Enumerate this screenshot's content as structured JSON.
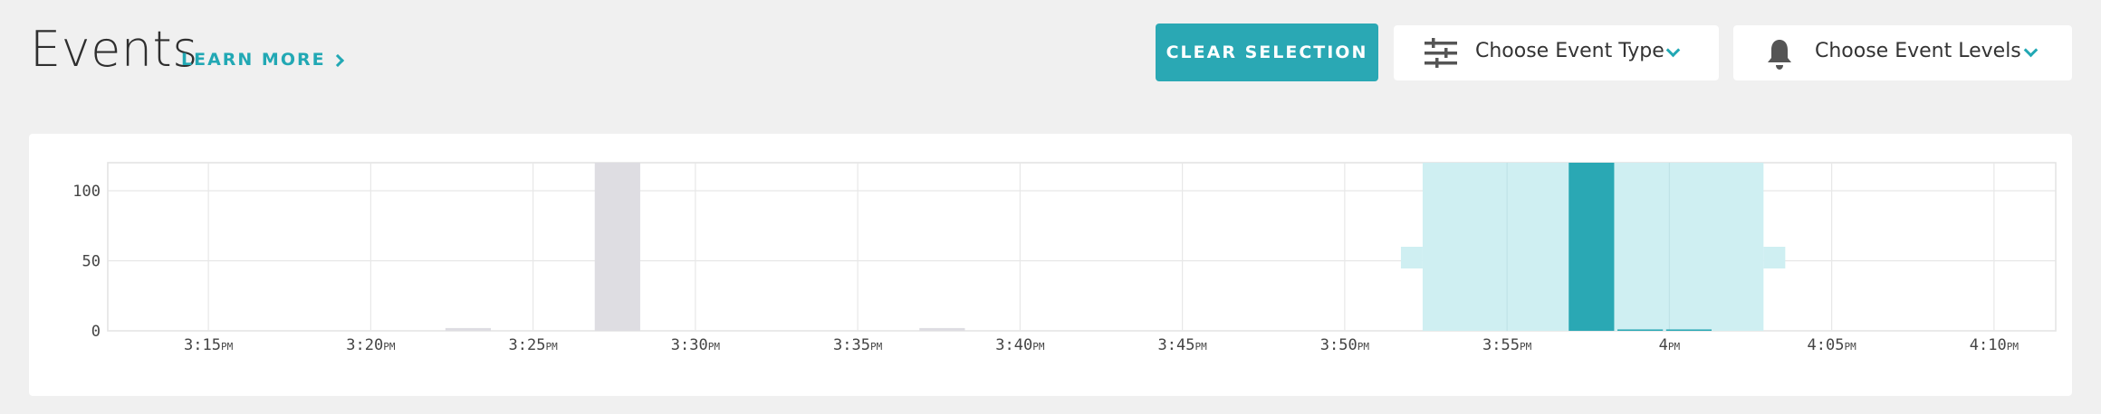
{
  "header": {
    "title": "Events",
    "learn_more": "LEARN MORE"
  },
  "toolbar": {
    "clear_selection": "CLEAR SELECTION",
    "event_type": {
      "label": "Choose Event Type",
      "icon": "sliders-icon"
    },
    "event_levels": {
      "label": "Choose Event Levels",
      "icon": "bell-icon"
    }
  },
  "colors": {
    "accent": "#2aa8b4",
    "selection": "#cfeff2",
    "bar_gray": "#dedde2",
    "background": "#f0f0f0"
  },
  "chart_data": {
    "type": "bar",
    "y_ticks": [
      "0",
      "50",
      "100"
    ],
    "ylim": [
      0,
      120
    ],
    "x_ticks": [
      {
        "label": "3:15",
        "suffix": "PM"
      },
      {
        "label": "3:20",
        "suffix": "PM"
      },
      {
        "label": "3:25",
        "suffix": "PM"
      },
      {
        "label": "3:30",
        "suffix": "PM"
      },
      {
        "label": "3:35",
        "suffix": "PM"
      },
      {
        "label": "3:40",
        "suffix": "PM"
      },
      {
        "label": "3:45",
        "suffix": "PM"
      },
      {
        "label": "3:50",
        "suffix": "PM"
      },
      {
        "label": "3:55",
        "suffix": "PM"
      },
      {
        "label": "4",
        "suffix": "PM"
      },
      {
        "label": "4:05",
        "suffix": "PM"
      },
      {
        "label": "4:10",
        "suffix": "PM"
      }
    ],
    "x_tick_minutes": [
      195,
      200,
      205,
      210,
      215,
      220,
      225,
      230,
      235,
      240,
      245,
      250
    ],
    "x_range_minutes": [
      191.9,
      251.9
    ],
    "bars": [
      {
        "start": 202.3,
        "end": 203.7,
        "value": 2,
        "style": "gray"
      },
      {
        "start": 206.9,
        "end": 208.3,
        "value": 120,
        "style": "gray"
      },
      {
        "start": 216.9,
        "end": 218.3,
        "value": 2,
        "style": "gray"
      },
      {
        "start": 236.9,
        "end": 238.3,
        "value": 120,
        "style": "accent"
      },
      {
        "start": 238.4,
        "end": 239.8,
        "value": 1,
        "style": "accent"
      },
      {
        "start": 239.9,
        "end": 241.3,
        "value": 1,
        "style": "accent"
      }
    ],
    "selection": {
      "start": 232.4,
      "end": 242.9
    },
    "grid": true
  }
}
